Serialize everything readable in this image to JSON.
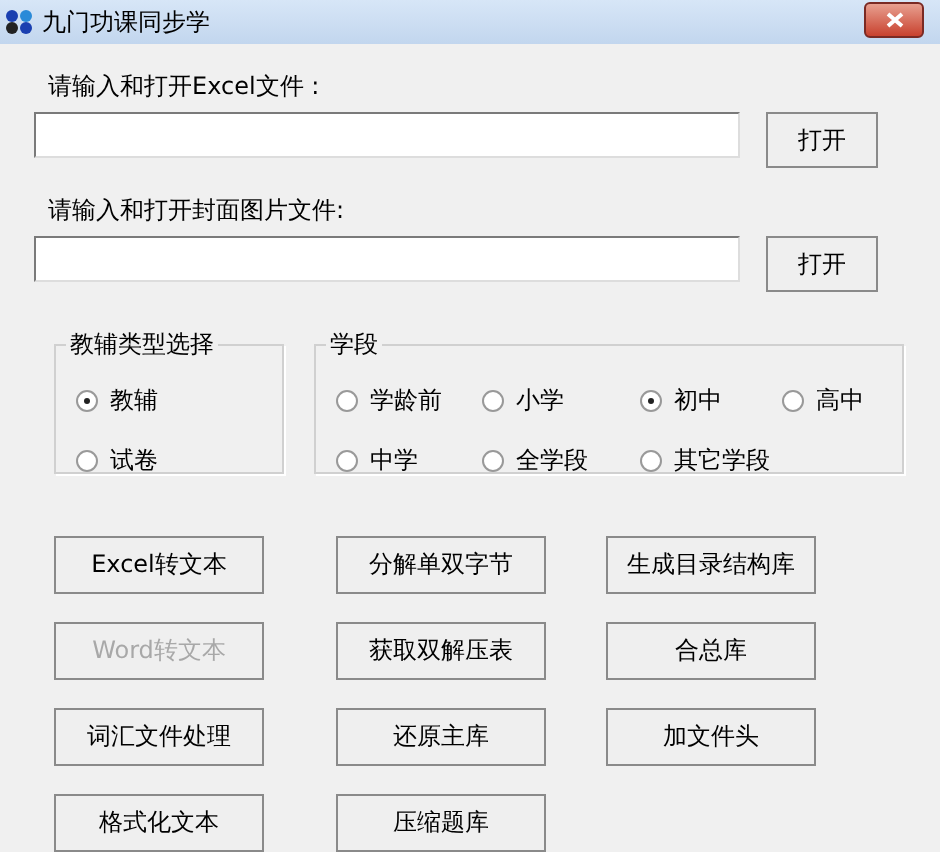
{
  "window": {
    "title": "九门功课同步学"
  },
  "file_inputs": [
    {
      "label": "请输入和打开Excel文件 :",
      "button": "打开"
    },
    {
      "label": "请输入和打开封面图片文件:",
      "button": "打开"
    }
  ],
  "groups": [
    {
      "kind": "column",
      "title": "教辅类型选择",
      "options": [
        {
          "label": "教辅",
          "selected": true
        },
        {
          "label": "试卷",
          "selected": false
        }
      ]
    },
    {
      "kind": "grid",
      "title": "学段",
      "options": [
        {
          "label": "学龄前",
          "selected": false
        },
        {
          "label": "小学",
          "selected": false
        },
        {
          "label": "初中",
          "selected": true
        },
        {
          "label": "高中",
          "selected": false
        },
        {
          "label": "中学",
          "selected": false
        },
        {
          "label": "全学段",
          "selected": false
        },
        {
          "label": "其它学段",
          "selected": false
        }
      ]
    }
  ],
  "buttons": [
    {
      "label": "Excel转文本",
      "disabled": false
    },
    {
      "label": "分解单双字节",
      "disabled": false
    },
    {
      "label": "生成目录结构库",
      "disabled": false
    },
    {
      "label": "Word转文本",
      "disabled": true
    },
    {
      "label": "获取双解压表",
      "disabled": false
    },
    {
      "label": "合总库",
      "disabled": false
    },
    {
      "label": "词汇文件处理",
      "disabled": false
    },
    {
      "label": "还原主库",
      "disabled": false
    },
    {
      "label": "加文件头",
      "disabled": false
    },
    {
      "label": "格式化文本",
      "disabled": false
    },
    {
      "label": "压缩题库",
      "disabled": false
    }
  ]
}
